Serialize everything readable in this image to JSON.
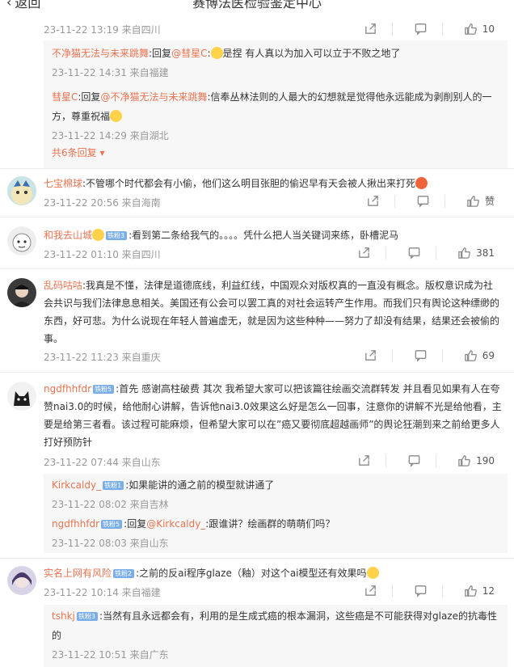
{
  "header": {
    "back_label": "返回",
    "title": "赛博法医检验鉴定中心"
  },
  "top_comment_meta": {
    "meta": "23-11-22 13:19 来自四川",
    "likes": "10"
  },
  "top_replies": [
    {
      "user": "不净猫无法与未来跳舞",
      "prefix": ":回复",
      "mention": "@彗星C",
      "text_a": ":",
      "text_b": "是捏 有人真以为加入可以立于不败之地了",
      "meta": "23-11-22 14:31 来自福建"
    },
    {
      "user": "彗星C",
      "prefix": ":回复",
      "mention": "@不净猫无法与未来跳舞",
      "text_a": ":信奉丛林法则的人最大的幻想就是觉得他永远能成为剥削别人的一方，尊重祝福",
      "meta": "23-11-22 14:29 来自湖北"
    }
  ],
  "more_replies_label": "共6条回复",
  "comments": [
    {
      "user": "七宝棉球",
      "text": ":不管哪个时代都会有小偷，他们这么明目张胆的偷迟早有天会被人揪出来打死",
      "meta": "23-11-22 20:56 来自海南",
      "likes": "赞"
    },
    {
      "user": "和我去山城",
      "badge": "铁粉3",
      "text": ":看到第二条给我气的。。。。凭什么把人当关键词来练，卧槽泥马",
      "meta": "23-11-22 01:10 来自四川",
      "likes": "381"
    },
    {
      "user": "乱码咕咕",
      "text": ":我真是不懂，法律是道德底线，利益红线，中国观众对版权真的一直没有概念。版权意识成为社会共识与我们法律息息相关。美国还有公会可以罢工真的对社会运转产生作用。而我们只有舆论这种缥缈的东西，好可悲。为什么说现在年轻人普遍虚无，就是因为这些种种——努力了却没有结果，结果还会被偷的事。",
      "meta": "23-11-22 11:23 来自重庆",
      "likes": "69"
    },
    {
      "user": "ngdfhhfdr",
      "badge": "铁粉5",
      "text": ":首先 感谢高柱破费 其次 我希望大家可以把该篇往绘画交流群转发 并且看见如果有人在夸赞nai3.0的时候，给他耐心讲解，告诉他nai3.0效果这么好是怎么一回事，注意你的讲解不光是给他看，主要是给第三者看。该过程可能麻烦，但希望大家可以在”癌又要彻底超越画师”的舆论狂潮到来之前给更多人打好预防针",
      "meta": "23-11-22 07:44 来自山东",
      "likes": "190"
    },
    {
      "user": "实名上网有风险",
      "badge": "铁粉2",
      "text": ":之前的反ai程序glaze（釉）对这个ai模型还有效果吗",
      "meta": "23-11-22 10:14 来自福建",
      "likes": "12"
    }
  ],
  "sub_replies_a": [
    {
      "user": "Kirkcaldy_",
      "badge": "铁粉1",
      "text": ":如果能讲的通之前的模型就讲通了",
      "meta": "23-11-22 08:02 来自吉林"
    },
    {
      "user": "ngdfhhfdr",
      "badge": "铁粉5",
      "prefix": ":回复",
      "mention": "@Kirkcaldy_",
      "text": ":跟谁讲？绘画群的萌萌们吗？",
      "meta": "23-11-22 08:03 来自山东"
    }
  ],
  "sub_replies_b": [
    {
      "user": "tshkj",
      "badge": "铁粉3",
      "text": ":当然有且永远都会有，利用的是生成式癌的根本漏洞，这些癌是不可能获得对glaze的抗毒性的",
      "meta": "23-11-22 10:51 来自广东"
    }
  ],
  "colors": {
    "username": "#eb7350",
    "meta": "#999999",
    "badge": "#7aaee8",
    "reply_bg": "#f7f7f7"
  }
}
